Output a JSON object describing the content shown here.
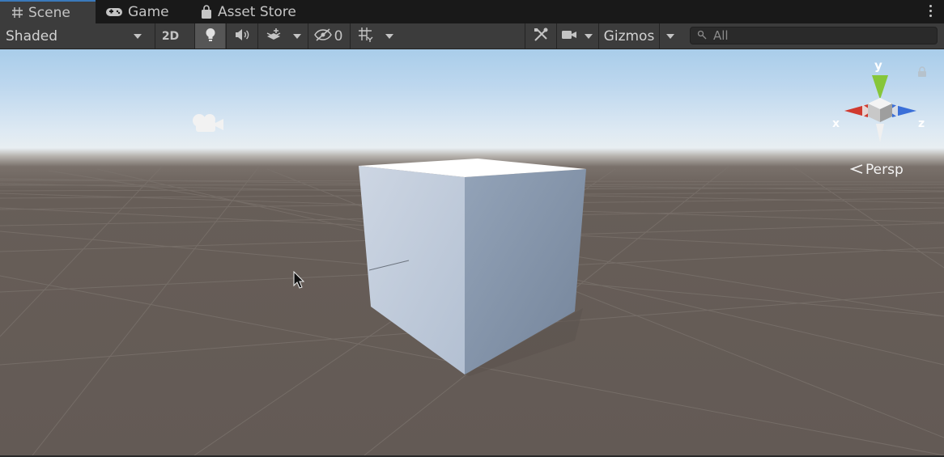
{
  "tabs": [
    {
      "label": "Scene",
      "icon": "hash-icon",
      "active": true
    },
    {
      "label": "Game",
      "icon": "gamepad-icon",
      "active": false
    },
    {
      "label": "Asset Store",
      "icon": "shopping-bag-icon",
      "active": false
    }
  ],
  "toolbar": {
    "draw_mode": "Shaded",
    "mode_2d": "2D",
    "hidden_count": "0",
    "gizmos_label": "Gizmos",
    "search_placeholder": "All"
  },
  "scene": {
    "projection_label": "Persp",
    "gizmo_axes": {
      "x": "x",
      "y": "y",
      "z": "z"
    },
    "objects": [
      "cube",
      "camera"
    ]
  },
  "colors": {
    "accent": "#3a79bb",
    "axis_x": "#d03a2f",
    "axis_y": "#86c63a",
    "axis_z": "#3a6fd8",
    "ground": "#665d57",
    "toolbar_bg": "#3c3c3c"
  }
}
